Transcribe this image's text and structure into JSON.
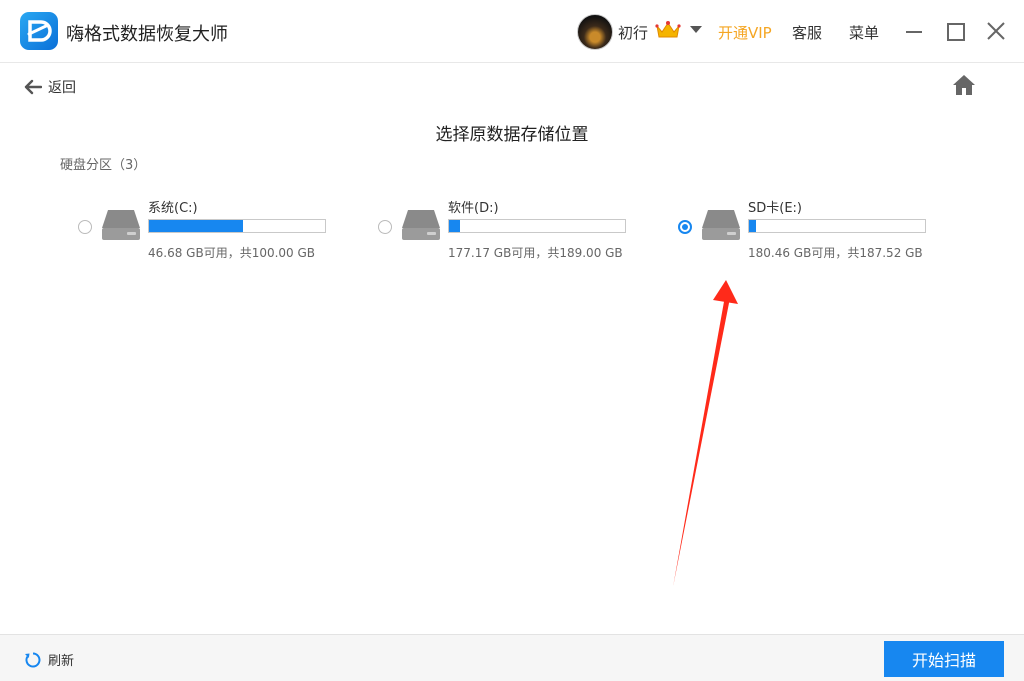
{
  "app": {
    "title": "嗨格式数据恢复大师",
    "logo_icon": "app-logo-d",
    "accent_color": "#1787f0"
  },
  "user": {
    "name": "初行",
    "vip_label": "开通VIP",
    "vip_color": "#f5a623",
    "service_label": "客服",
    "menu_label": "菜单"
  },
  "nav": {
    "back_label": "返回",
    "home_icon": "home-icon"
  },
  "page": {
    "title": "选择原数据存储位置",
    "section_label": "硬盘分区（3）"
  },
  "drives": [
    {
      "name": "系统(C:)",
      "info": "46.68 GB可用，共100.00 GB",
      "used_fraction": 0.533,
      "selected": false
    },
    {
      "name": "软件(D:)",
      "info": "177.17 GB可用，共189.00 GB",
      "used_fraction": 0.063,
      "selected": false
    },
    {
      "name": "SD卡(E:)",
      "info": "180.46 GB可用，共187.52 GB",
      "used_fraction": 0.038,
      "selected": true
    }
  ],
  "footer": {
    "refresh_label": "刷新",
    "scan_label": "开始扫描"
  }
}
